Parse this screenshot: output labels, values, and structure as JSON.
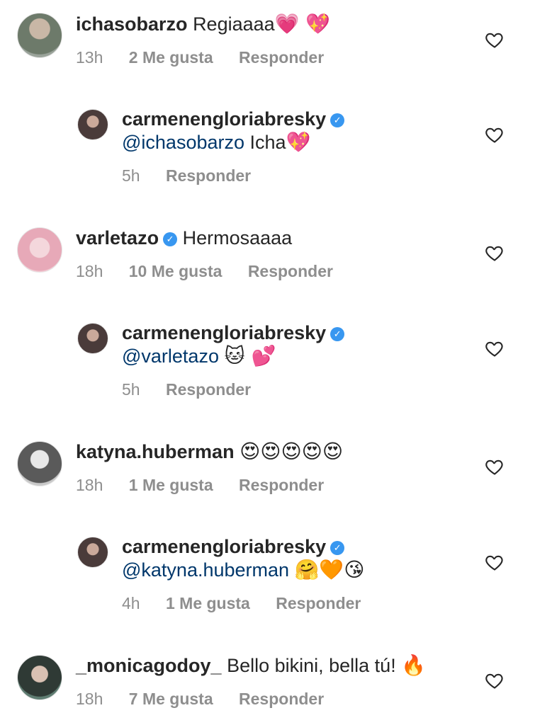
{
  "comments": [
    {
      "username": "ichasobarzo",
      "text": "Regiaaaa",
      "emoji": "💗 💖",
      "time": "13h",
      "likes": "2 Me gusta",
      "reply": "Responder",
      "avatar_color": "#8a8f86"
    },
    {
      "username": "carmenengloriabresky",
      "verified": true,
      "mention": "@ichasobarzo",
      "text": "Icha",
      "emoji": "💖",
      "time": "5h",
      "reply": "Responder",
      "avatar_color": "#5b4a48"
    },
    {
      "username": "varletazo",
      "verified": true,
      "text": "Hermosaaaa",
      "time": "18h",
      "likes": "10 Me gusta",
      "reply": "Responder",
      "avatar_color": "#e9b3c0"
    },
    {
      "username": "carmenengloriabresky",
      "verified": true,
      "mention": "@varletazo",
      "emoji": "🐱 💕",
      "time": "5h",
      "reply": "Responder",
      "avatar_color": "#5b4a48"
    },
    {
      "username": "katyna.huberman",
      "emoji": "😍😍😍😍😍",
      "time": "18h",
      "likes": "1 Me gusta",
      "reply": "Responder",
      "avatar_color": "#9a9a9a"
    },
    {
      "username": "carmenengloriabresky",
      "verified": true,
      "mention": "@katyna.huberman",
      "emoji": "🤗🧡😘",
      "time": "4h",
      "likes": "1 Me gusta",
      "reply": "Responder",
      "avatar_color": "#5b4a48"
    },
    {
      "username": "_monicagodoy_",
      "text": "Bello bikini, bella tú!",
      "emoji": "🔥",
      "time": "18h",
      "likes": "7 Me gusta",
      "reply": "Responder",
      "avatar_color": "#4d6a60"
    }
  ],
  "icons": {
    "like": "heart-outline-icon",
    "verified": "verified-badge-icon"
  },
  "colors": {
    "text": "#262626",
    "meta": "#8e8e8e",
    "mention": "#00376b",
    "verified": "#3897f0"
  }
}
